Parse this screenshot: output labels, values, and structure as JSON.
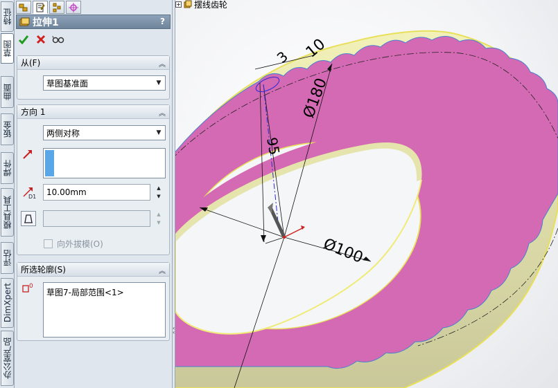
{
  "vertical_tabs": [
    "特征",
    "草图",
    "曲面",
    "钣金",
    "焊件",
    "模具工具",
    "评估",
    "DimXpert",
    "办公室产品"
  ],
  "panel": {
    "title": "拉伸1",
    "help": "?",
    "from": {
      "header": "从(F)",
      "value": "草图基准面"
    },
    "direction1": {
      "header": "方向 1",
      "end_condition": "两侧对称",
      "depth": "10.00mm",
      "draft_outward_label": "向外拔模(O)"
    },
    "selected_contours": {
      "header": "所选轮廓(S)",
      "items": [
        "草图7-局部范围<1>"
      ]
    }
  },
  "viewport": {
    "tree_item": "摆线齿轮",
    "dimensions": {
      "d_top": "10",
      "d_small": "3",
      "d_180": "Ø180",
      "d_95": "95",
      "d_100": "Ø100"
    }
  },
  "colors": {
    "part_pink": "#d46ab4",
    "part_edge": "#f7f27a",
    "panel_bg": "#dfe6ee",
    "title_bar": "#7a8ea5"
  }
}
